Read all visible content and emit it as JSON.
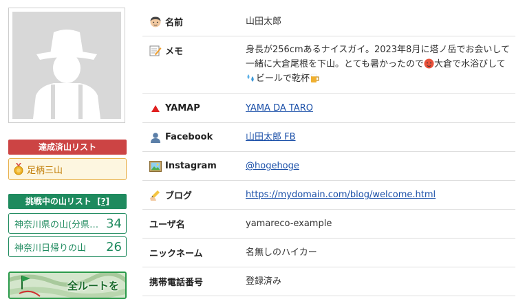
{
  "sidebar": {
    "achieved_header": "達成済山リスト",
    "achieved_items": [
      {
        "label": "足柄三山"
      }
    ],
    "challenge_header": "挑戦中の山リスト",
    "challenge_help": "[?]",
    "challenge_items": [
      {
        "label": "神奈川県の山(分県登山ガイド)",
        "count": "34"
      },
      {
        "label": "神奈川日帰りの山",
        "count": "26"
      }
    ],
    "map_banner_label": "全ルートを"
  },
  "profile": {
    "name": {
      "key": "名前",
      "value": "山田太郎",
      "icon": "person-face-icon"
    },
    "memo": {
      "key": "メモ",
      "icon": "memo-icon",
      "text1": "身長が256cmあるナイスガイ。2023年8月に塔ノ岳でお会いして一緒に大倉尾根を下山。とても暑かったので",
      "text2": "大倉で水浴びして",
      "text3": "ビールで乾杯"
    },
    "yamap": {
      "key": "YAMAP",
      "value": "YAMA DA TARO",
      "icon": "red-triangle-icon"
    },
    "facebook": {
      "key": "Facebook",
      "value": "山田太郎 FB",
      "icon": "person-silhouette-icon"
    },
    "instagram": {
      "key": "Instagram",
      "value": "@hogehoge",
      "icon": "framed-picture-icon"
    },
    "blog": {
      "key": "ブログ",
      "value": "https://mydomain.com/blog/welcome.html",
      "icon": "writing-hand-icon"
    },
    "username": {
      "key": "ユーザ名",
      "value": "yamareco-example"
    },
    "nickname": {
      "key": "ニックネーム",
      "value": "名無しのハイカー"
    },
    "phone": {
      "key": "携帯電話番号",
      "value": "登録済み"
    }
  },
  "colors": {
    "achieved_header_bg": "#cc4444",
    "challenge_green": "#1e8a5e",
    "achieved_item_bg": "#fdf6e0",
    "link_blue": "#1a4fa8"
  }
}
